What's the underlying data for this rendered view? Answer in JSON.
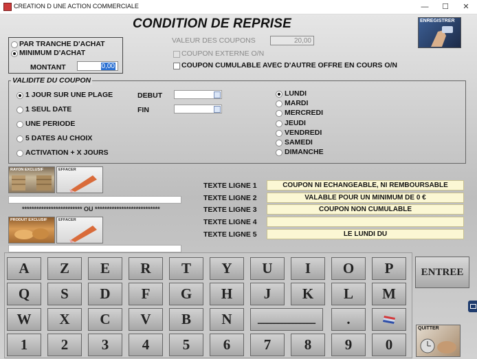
{
  "window": {
    "title": "CREATION D UNE ACTION COMMERCIALE",
    "minimize": "—",
    "maximize": "☐",
    "close": "✕"
  },
  "page_title": "CONDITION DE REPRISE",
  "save_label": "ENREGISTRER",
  "quit_label": "QUITTER",
  "purchase": {
    "option1": "PAR TRANCHE D'ACHAT",
    "option2": "MINIMUM D'ACHAT",
    "amount_label": "MONTANT",
    "amount_value": "0,00"
  },
  "coupons": {
    "value_label": "VALEUR DES COUPONS",
    "value": "20,00",
    "external_label": "COUPON EXTERNE O/N",
    "cumulable_label": "COUPON CUMULABLE AVEC D'AUTRE OFFRE EN COURS O/N"
  },
  "validity": {
    "legend": "VALIDITE DU COUPON",
    "options": [
      "1 JOUR SUR UNE PLAGE",
      "1 SEUL DATE",
      "UNE PERIODE",
      "5 DATES AU CHOIX",
      "ACTIVATION + X JOURS"
    ],
    "debut_label": "DEBUT",
    "fin_label": "FIN",
    "days": [
      "LUNDI",
      "MARDI",
      "MERCREDI",
      "JEUDI",
      "VENDREDI",
      "SAMEDI",
      "DIMANCHE"
    ]
  },
  "tiles": {
    "rayon": "RAYON EXCLUSIF",
    "effacer": "EFFACER",
    "produit": "PRODUIT EXCLUSIF",
    "ou": "************************* OU ***************************"
  },
  "text_lines": [
    {
      "label": "TEXTE LIGNE 1",
      "value": "COUPON NI ECHANGEABLE, NI REMBOURSABLE"
    },
    {
      "label": "TEXTE LIGNE 2",
      "value": "VALABLE POUR UN MINIMUM DE 0 €"
    },
    {
      "label": "TEXTE LIGNE 3",
      "value": "COUPON NON CUMULABLE"
    },
    {
      "label": "TEXTE LIGNE 4",
      "value": ""
    },
    {
      "label": "TEXTE LIGNE 5",
      "value": "LE LUNDI DU"
    }
  ],
  "keyboard": {
    "row1": [
      "A",
      "Z",
      "E",
      "R",
      "T",
      "Y",
      "U",
      "I",
      "O",
      "P"
    ],
    "row2": [
      "Q",
      "S",
      "D",
      "F",
      "G",
      "H",
      "J",
      "K",
      "L",
      "M"
    ],
    "row3": [
      "W",
      "X",
      "C",
      "V",
      "B",
      "N"
    ],
    "space": "________",
    "dot": ".",
    "row4": [
      "1",
      "2",
      "3",
      "4",
      "5",
      "6",
      "7",
      "8",
      "9",
      "0"
    ],
    "enter": "ENTREE"
  }
}
